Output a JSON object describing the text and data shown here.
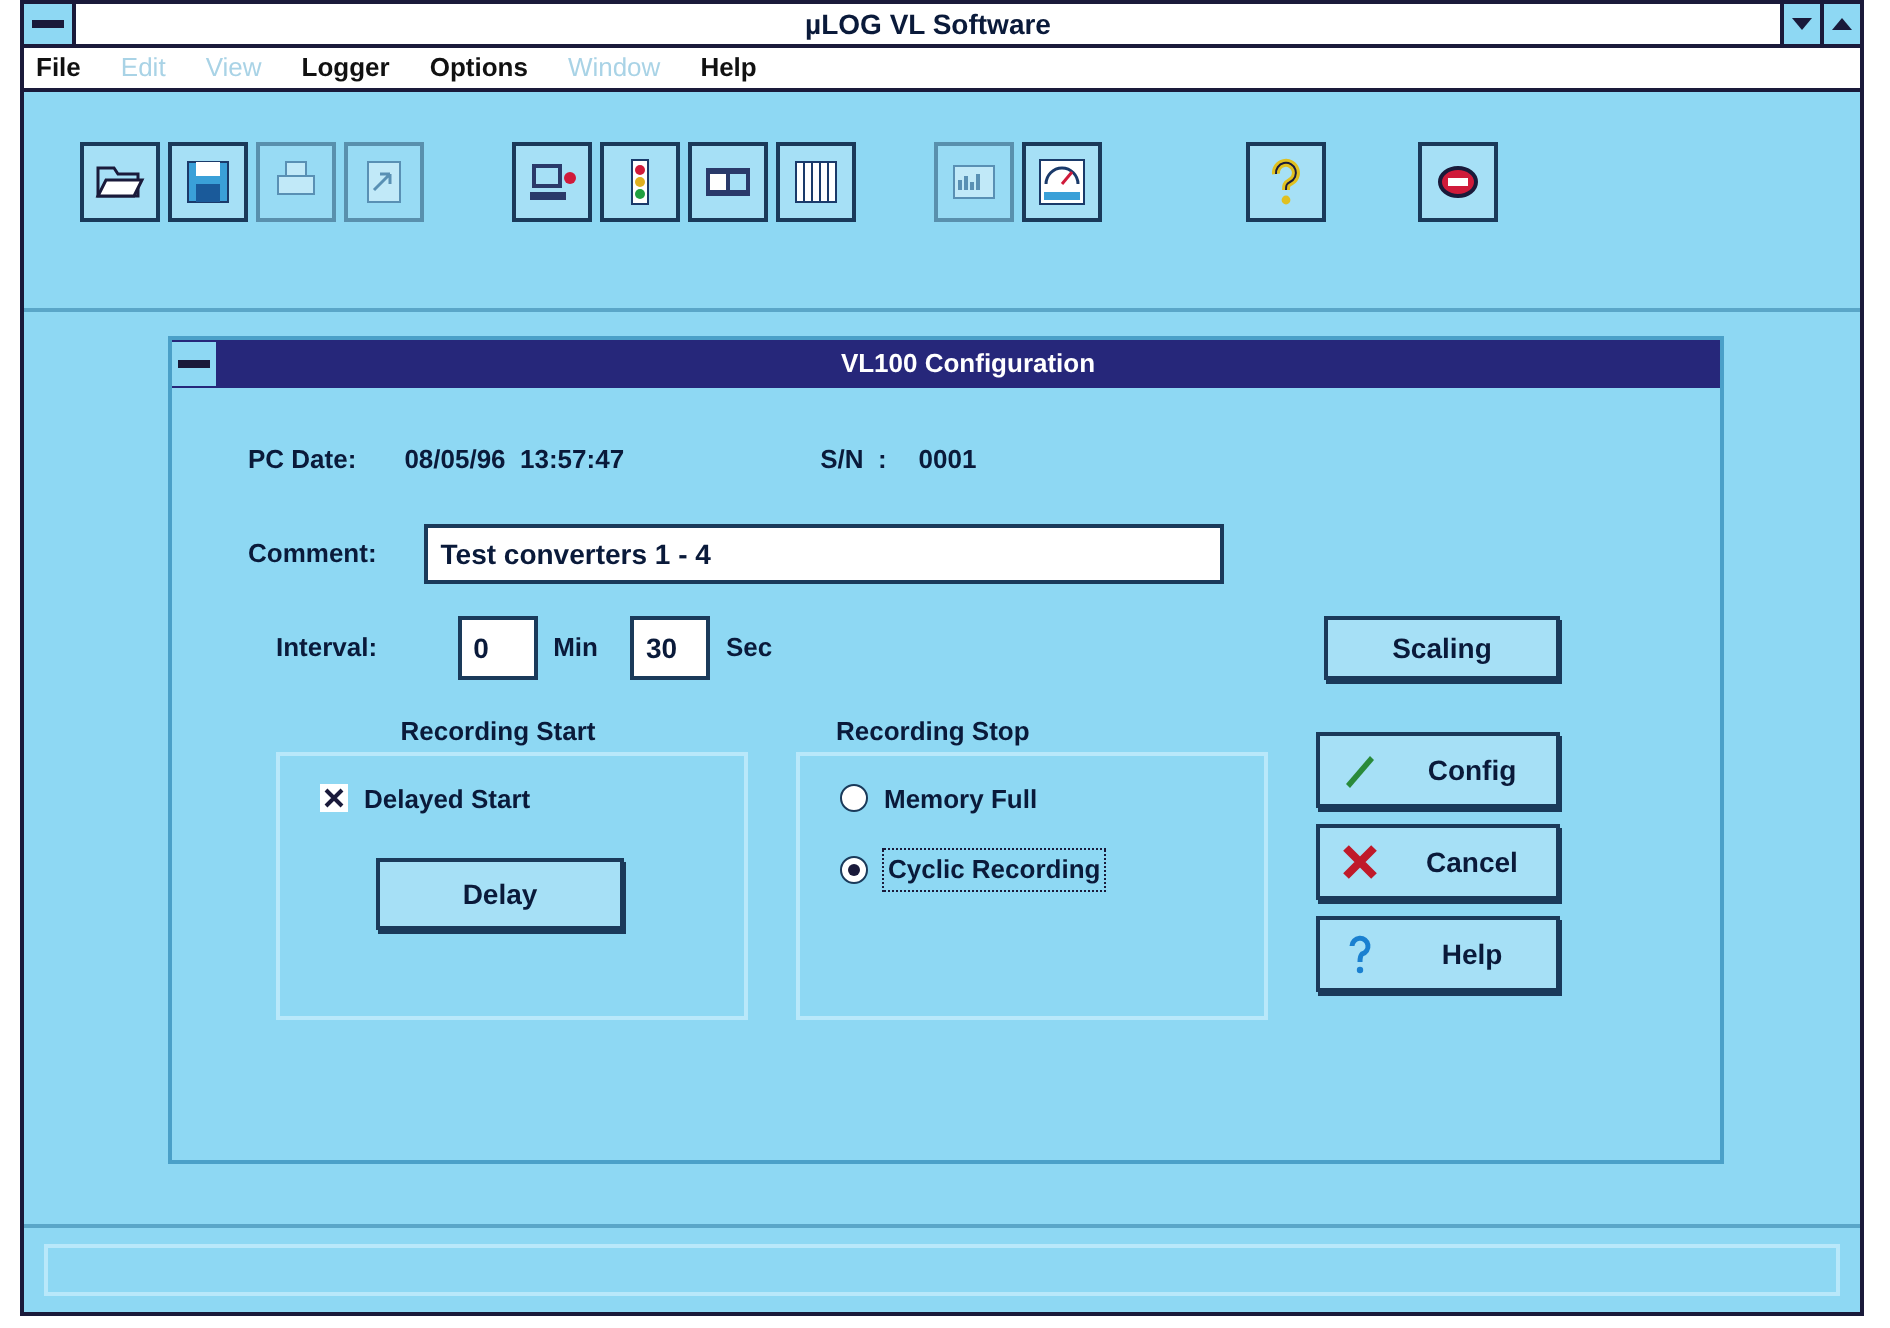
{
  "window": {
    "title": "µLOG VL Software"
  },
  "menu": [
    {
      "label": "File",
      "disabled": false
    },
    {
      "label": "Edit",
      "disabled": true
    },
    {
      "label": "View",
      "disabled": true
    },
    {
      "label": "Logger",
      "disabled": false
    },
    {
      "label": "Options",
      "disabled": false
    },
    {
      "label": "Window",
      "disabled": true
    },
    {
      "label": "Help",
      "disabled": false
    }
  ],
  "toolbar": [
    [
      {
        "kind": "folder",
        "disabled": false
      },
      {
        "kind": "disk",
        "disabled": false
      },
      {
        "kind": "printer",
        "disabled": true
      },
      {
        "kind": "export",
        "disabled": true
      }
    ],
    [
      {
        "kind": "computer",
        "disabled": false
      },
      {
        "kind": "lights",
        "disabled": false
      },
      {
        "kind": "display",
        "disabled": false
      },
      {
        "kind": "columns",
        "disabled": false
      }
    ],
    [
      {
        "kind": "graph",
        "disabled": true
      },
      {
        "kind": "gauge",
        "disabled": false
      }
    ],
    [
      {
        "kind": "question",
        "disabled": false
      }
    ],
    [
      {
        "kind": "exit",
        "disabled": false
      }
    ]
  ],
  "dialog": {
    "title": "VL100  Configuration",
    "pc_date_label": "PC Date:",
    "pc_date": "08/05/96  13:57:47",
    "sn_label": "S/N  :",
    "sn": "0001",
    "comment_label": "Comment:",
    "comment": "Test converters 1 - 4",
    "interval_label": "Interval:",
    "minutes": "0",
    "min_label": "Min",
    "seconds": "30",
    "sec_label": "Sec",
    "scaling_button": "Scaling",
    "recording_start": {
      "title": "Recording Start",
      "checkbox": {
        "label": "Delayed Start",
        "checked": true
      },
      "button": "Delay"
    },
    "recording_stop": {
      "title": "Recording Stop",
      "options": [
        {
          "label": "Memory Full",
          "selected": false
        },
        {
          "label": "Cyclic Recording",
          "selected": true
        }
      ]
    },
    "buttons": [
      {
        "kind": "config",
        "label": "Config"
      },
      {
        "kind": "cancel",
        "label": "Cancel"
      },
      {
        "kind": "help",
        "label": "Help"
      }
    ]
  }
}
